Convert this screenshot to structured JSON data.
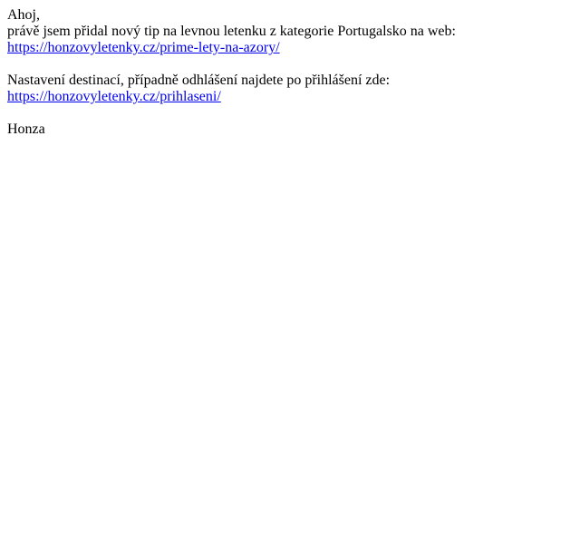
{
  "email": {
    "greeting": "Ahoj,",
    "intro": "právě jsem přidal nový tip na levnou letenku z kategorie Portugalsko na web:",
    "tip_link": "https://honzovyletenky.cz/prime-lety-na-azory/",
    "settings_text": "Nastavení destinací, případně odhlášení najdete po přihlášení zde:",
    "login_link": "https://honzovyletenky.cz/prihlaseni/",
    "signature": "Honza"
  },
  "colors": {
    "text": "#000000",
    "link": "#0000ee",
    "background": "#ffffff"
  }
}
